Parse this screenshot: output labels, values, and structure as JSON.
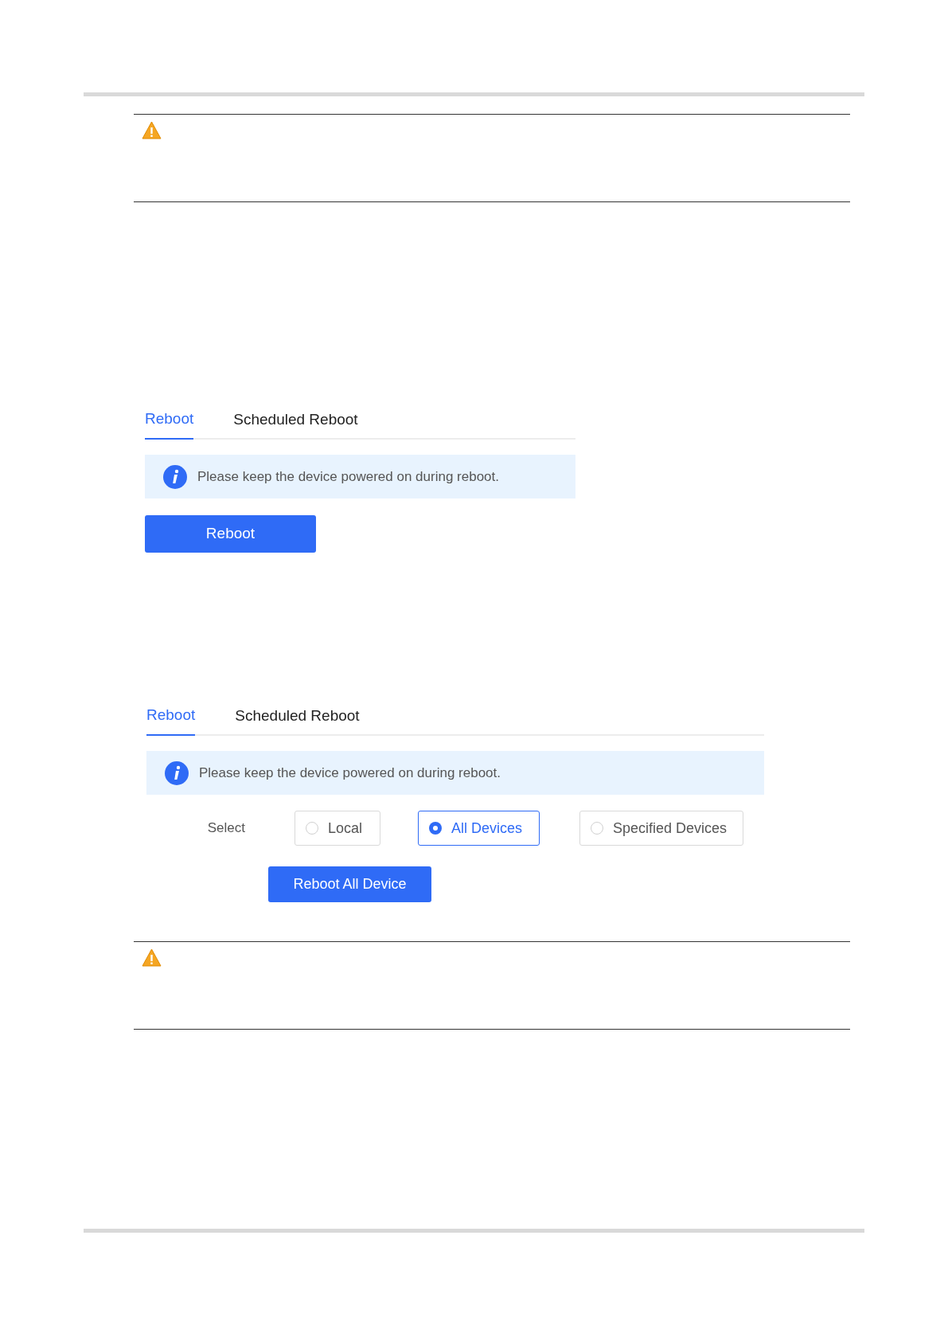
{
  "screens": [
    {
      "tabs": [
        {
          "label": "Reboot",
          "selected": true
        },
        {
          "label": "Scheduled Reboot",
          "selected": false
        }
      ],
      "notice": "Please keep the device powered on during reboot.",
      "button": "Reboot"
    },
    {
      "tabs": [
        {
          "label": "Reboot",
          "selected": true
        },
        {
          "label": "Scheduled Reboot",
          "selected": false
        }
      ],
      "notice": "Please keep the device powered on during reboot.",
      "select": {
        "label": "Select",
        "options": [
          {
            "label": "Local",
            "selected": false
          },
          {
            "label": "All Devices",
            "selected": true
          },
          {
            "label": "Specified Devices",
            "selected": false
          }
        ]
      },
      "button": "Reboot All Device"
    }
  ]
}
